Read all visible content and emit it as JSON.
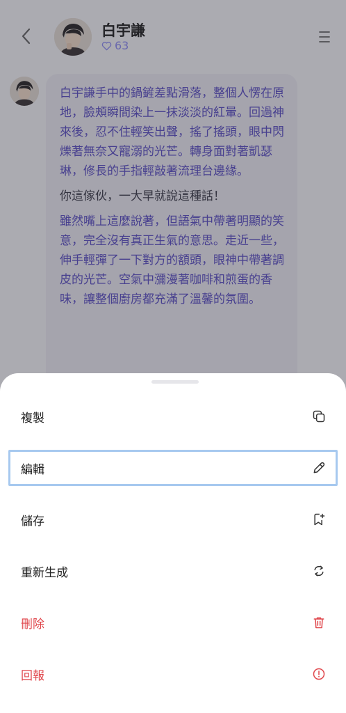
{
  "header": {
    "character_name": "白宇謙",
    "likes": "63"
  },
  "message": {
    "paragraphs": [
      "白宇謙手中的鍋鏟差點滑落，整個人愣在原地，臉頰瞬間染上一抹淡淡的紅暈。回過神來後，忍不住輕笑出聲，搖了搖頭，眼中閃爍著無奈又寵溺的光芒。轉身面對著凱瑟琳，修長的手指輕敲著流理台邊緣。",
      "你這傢伙，一大早就說這種話！",
      "雖然嘴上這麼說著，但語氣中帶著明顯的笑意，完全沒有真正生氣的意思。走近一些，伸手輕彈了一下對方的額頭，眼神中帶著調皮的光芒。空氣中瀰漫著咖啡和煎蛋的香味，讓整個廚房都充滿了溫馨的氛圍。"
    ]
  },
  "sheet": {
    "items": [
      {
        "label": "複製",
        "icon": "copy-icon"
      },
      {
        "label": "編輯",
        "icon": "pencil-icon"
      },
      {
        "label": "儲存",
        "icon": "bookmark-add-icon"
      },
      {
        "label": "重新生成",
        "icon": "regenerate-icon"
      },
      {
        "label": "刪除",
        "icon": "trash-icon"
      },
      {
        "label": "回報",
        "icon": "alert-icon"
      }
    ]
  },
  "colors": {
    "accent": "#8f8ef2",
    "narration_text": "#5b4fc4",
    "danger": "#e0474c",
    "selection_outline": "#a7c9ef"
  }
}
